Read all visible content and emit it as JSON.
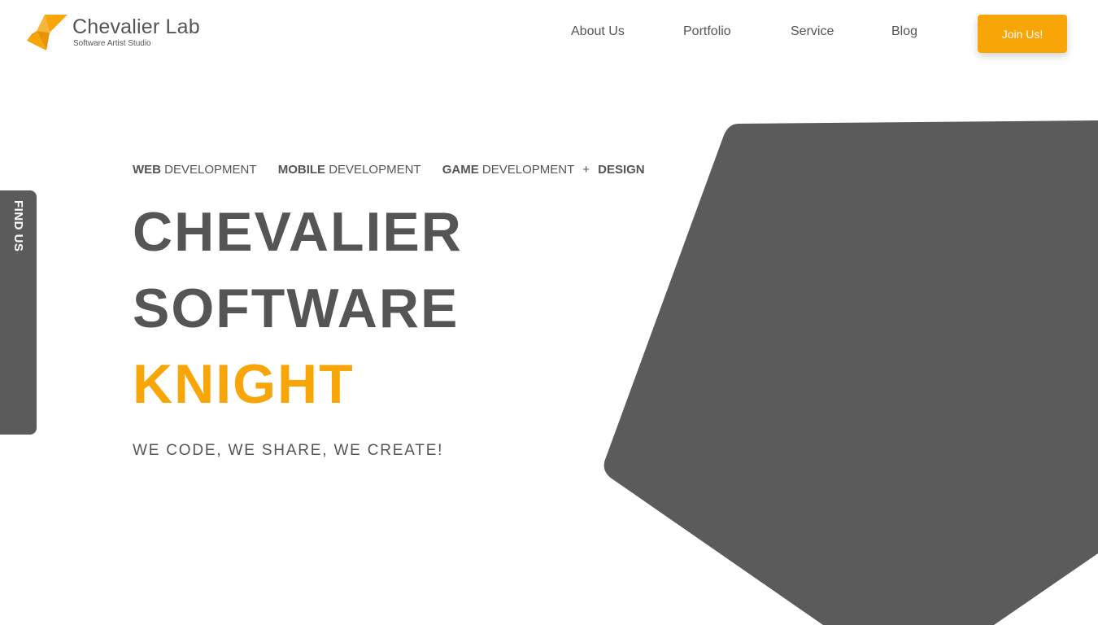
{
  "header": {
    "logo_title": "Chevalier Lab",
    "logo_subtitle": "Software Artist Studio",
    "nav": {
      "about": "About Us",
      "portfolio": "Portfolio",
      "service": "Service",
      "blog": "Blog"
    },
    "join_label": "Join Us!"
  },
  "side_tab": {
    "label": "FIND US"
  },
  "hero": {
    "services": [
      {
        "bold": "WEB",
        "rest": "DEVELOPMENT"
      },
      {
        "bold": "MOBILE",
        "rest": "DEVELOPMENT"
      },
      {
        "bold": "GAME",
        "rest": "DEVELOPMENT"
      }
    ],
    "plus": "+",
    "design": "DESIGN",
    "title_line1": "CHEVALIER",
    "title_line2": "SOFTWARE",
    "title_line3": "KNIGHT",
    "tagline": "WE CODE, WE SHARE, WE CREATE!"
  },
  "colors": {
    "accent": "#f8a508",
    "dark": "#5b5b5b",
    "text": "#555555",
    "background": "#ffffff"
  }
}
